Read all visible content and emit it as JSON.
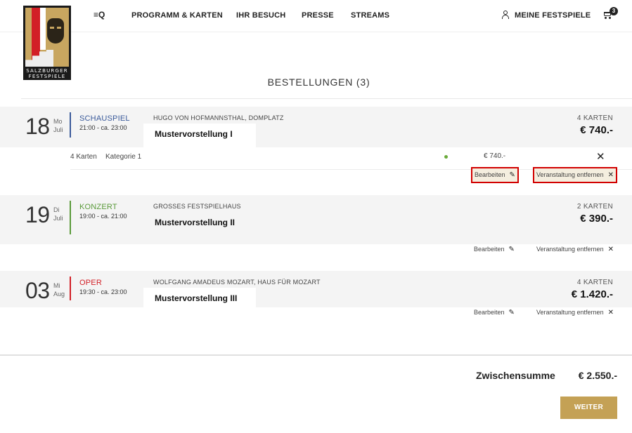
{
  "header": {
    "menu_label": "≡Q",
    "nav": [
      {
        "label": "PROGRAMM & KARTEN"
      },
      {
        "label": "IHR BESUCH"
      },
      {
        "label": "PRESSE"
      },
      {
        "label": "STREAMS"
      }
    ],
    "account_label": "MEINE FESTSPIELE",
    "cart_count": "3",
    "logo_line1": "SALZBURGER",
    "logo_line2": "FESTSPIELE"
  },
  "page_title": "BESTELLUNGEN (3)",
  "colors": {
    "schauspiel": "#3a5a9a",
    "konzert": "#5a9a3a",
    "oper": "#d21f26",
    "accent_gold": "#c4a155"
  },
  "events": [
    {
      "day": "18",
      "weekday": "Mo",
      "month": "Juli",
      "category": "SCHAUSPIEL",
      "time": "21:00 - ca. 23:00",
      "venue": "HUGO VON HOFMANNSTHAL, DOMPLATZ",
      "name": "Mustervorstellung I",
      "count": "4 KARTEN",
      "price": "€ 740.-",
      "detail": {
        "qty": "4 Karten",
        "category": "Kategorie 1",
        "price": "€ 740.-",
        "close": "✕"
      },
      "edit": "Bearbeiten",
      "remove": "Veranstaltung entfernen"
    },
    {
      "day": "19",
      "weekday": "Di",
      "month": "Juli",
      "category": "KONZERT",
      "time": "19:00 - ca. 21:00",
      "venue": "GROSSES FESTSPIELHAUS",
      "name": "Mustervorstellung II",
      "count": "2 KARTEN",
      "price": "€ 390.-",
      "edit": "Bearbeiten",
      "remove": "Veranstaltung entfernen"
    },
    {
      "day": "03",
      "weekday": "Mi",
      "month": "Aug",
      "category": "OPER",
      "time": "19:30 - ca. 23:00",
      "venue": "WOLFGANG AMADEUS MOZART, HAUS FÜR MOZART",
      "name": "Mustervorstellung III",
      "count": "4 KARTEN",
      "price": "€ 1.420.-",
      "edit": "Bearbeiten",
      "remove": "Veranstaltung entfernen"
    }
  ],
  "icons": {
    "edit": "pencil-icon",
    "remove": "x-icon",
    "account": "user-icon",
    "cart": "cart-icon"
  },
  "summary": {
    "label": "Zwischensumme",
    "value": "€ 2.550.-"
  },
  "continue_label": "WEITER"
}
